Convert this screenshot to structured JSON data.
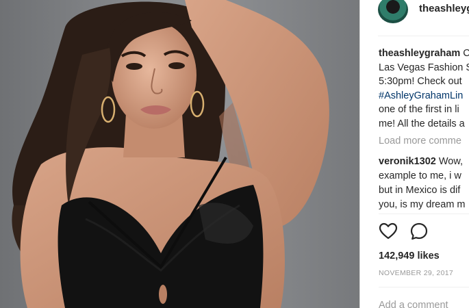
{
  "post": {
    "username": "theashleygraham",
    "caption_username": "theashleygraham",
    "caption_lines": [
      "Las Vegas Fashion S",
      "5:30pm!  Check out",
      "one of the first in li",
      "me! All the details a"
    ],
    "caption_first_tail": " C",
    "hashtag": "#AshleyGrahamLin",
    "load_more": "Load more comme",
    "comment": {
      "username": "veronik1302",
      "first_text": " Wow,",
      "lines": [
        "example to me, i w",
        "but in Mexico is dif",
        "you, is my dream m"
      ]
    },
    "likes": "142,949 likes",
    "date": "NOVEMBER 29, 2017",
    "add_comment_placeholder": "Add a comment"
  },
  "icons": {
    "like": "heart-outline-icon",
    "comment": "speech-bubble-icon"
  },
  "colors": {
    "text": "#262626",
    "muted": "#999999",
    "hashtag": "#003569",
    "divider": "#efefef"
  }
}
